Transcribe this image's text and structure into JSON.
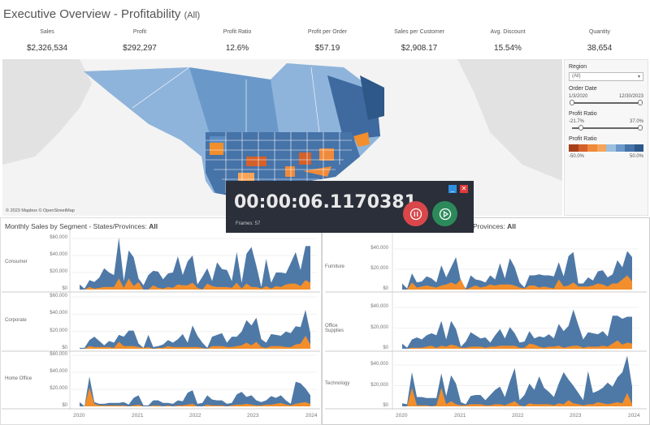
{
  "header": {
    "title": "Executive Overview - Profitability",
    "filter": "(All)"
  },
  "kpis": [
    {
      "label": "Sales",
      "value": "$2,326,534"
    },
    {
      "label": "Profit",
      "value": "$292,297"
    },
    {
      "label": "Profit Ratio",
      "value": "12.6%"
    },
    {
      "label": "Profit per Order",
      "value": "$57.19"
    },
    {
      "label": "Sales per Customer",
      "value": "$2,908.17"
    },
    {
      "label": "Avg. Discount",
      "value": "15.54%"
    },
    {
      "label": "Quantity",
      "value": "38,654"
    }
  ],
  "map": {
    "credit": "© 2023 Mapbox © OpenStreetMap"
  },
  "filters": {
    "region_label": "Region",
    "region_value": "(All)",
    "date_label": "Order Date",
    "date_min": "1/3/2020",
    "date_max": "12/30/2023",
    "ratio_label": "Profit Ratio",
    "ratio_min": "-21.7%",
    "ratio_max": "37.0%",
    "legend_label": "Profit Ratio",
    "legend_min": "-50.0%",
    "legend_max": "50.0%",
    "legend_colors": [
      "#a6401b",
      "#d4602a",
      "#ef8a3a",
      "#f5a55a",
      "#9cbfe0",
      "#6a99c9",
      "#4673a8",
      "#2d5888"
    ]
  },
  "recorder": {
    "time": "00:00:06.1170381",
    "frames": "Frames: 57",
    "minimize": "_",
    "close": "✕"
  },
  "colors": {
    "sales": "#4e79a7",
    "profit": "#f28e2b"
  },
  "chart_data": [
    {
      "type": "area",
      "title": "Monthly Sales by Segment - States/Provinces:",
      "title_bold": "All",
      "x_ticks": [
        "2020",
        "2021",
        "2022",
        "2023",
        "2024"
      ],
      "ylim": [
        0,
        60000
      ],
      "y_ticks": [
        "$60,000",
        "$40,000",
        "$20,000",
        "$0"
      ],
      "panels": [
        {
          "name": "Consumer",
          "sales": [
            6000,
            1000,
            11000,
            9000,
            14000,
            25000,
            20000,
            17000,
            61000,
            10000,
            46000,
            38000,
            13000,
            5000,
            17000,
            22000,
            21000,
            12000,
            19000,
            20000,
            39000,
            17000,
            33000,
            40000,
            6000,
            15000,
            25000,
            10000,
            32000,
            24000,
            23000,
            10000,
            44000,
            8000,
            42000,
            50000,
            28000,
            3000,
            36000,
            8000,
            20000,
            20000,
            19000,
            31000,
            44000,
            23000,
            51000,
            51000
          ],
          "profit": [
            0,
            0,
            3000,
            1000,
            2000,
            3000,
            3000,
            3000,
            13000,
            2000,
            13000,
            4000,
            9000,
            0,
            0,
            5000,
            2000,
            1000,
            3000,
            2000,
            6000,
            5000,
            5000,
            8000,
            2000,
            0,
            7000,
            4000,
            3000,
            3000,
            3000,
            2000,
            8000,
            1000,
            7000,
            3000,
            3000,
            1000,
            4000,
            1000,
            4000,
            3000,
            6000,
            7000,
            7000,
            4000,
            11000,
            8000
          ]
        },
        {
          "name": "Corporate",
          "sales": [
            1000,
            1000,
            10000,
            14000,
            9000,
            4000,
            9000,
            7000,
            16000,
            14000,
            21000,
            21000,
            6000,
            1000,
            16000,
            2000,
            3000,
            5000,
            10000,
            7000,
            11000,
            17000,
            7000,
            27000,
            15000,
            7000,
            1000,
            14000,
            16000,
            18000,
            7000,
            14000,
            14000,
            20000,
            33000,
            27000,
            36000,
            11000,
            7000,
            17000,
            16000,
            15000,
            20000,
            18000,
            26000,
            25000,
            45000,
            18000
          ],
          "profit": [
            0,
            0,
            3000,
            2000,
            2000,
            2000,
            2000,
            1000,
            8000,
            3000,
            3000,
            3000,
            2000,
            1000,
            2000,
            0,
            1000,
            1000,
            3000,
            2000,
            2000,
            2000,
            2000,
            2000,
            2000,
            1000,
            0,
            3000,
            3000,
            3000,
            2000,
            2000,
            3000,
            4000,
            7000,
            4000,
            8000,
            2000,
            1000,
            3000,
            3000,
            3000,
            2000,
            2000,
            5000,
            6000,
            15000,
            5000
          ]
        },
        {
          "name": "Home Office",
          "sales": [
            5000,
            0,
            35000,
            5000,
            3000,
            3000,
            4000,
            4000,
            4000,
            5000,
            2000,
            10000,
            13000,
            1000,
            1000,
            7000,
            7000,
            4000,
            4000,
            3000,
            7000,
            6000,
            16000,
            19000,
            3000,
            4000,
            13000,
            8000,
            7000,
            7000,
            3000,
            4000,
            14000,
            17000,
            11000,
            13000,
            7000,
            5000,
            7000,
            12000,
            10000,
            13000,
            7000,
            3000,
            29000,
            27000,
            21000,
            13000
          ],
          "profit": [
            0,
            0,
            22000,
            3000,
            1000,
            1000,
            1000,
            1000,
            1000,
            1000,
            0,
            1000,
            2000,
            0,
            0,
            1000,
            1000,
            0,
            1000,
            0,
            1000,
            1000,
            2000,
            3000,
            0,
            0,
            2000,
            1000,
            1000,
            1000,
            0,
            1000,
            2000,
            2000,
            3000,
            2000,
            1000,
            1000,
            2000,
            2000,
            3000,
            4000,
            2000,
            1000,
            3000,
            4000,
            5000,
            3000
          ]
        }
      ]
    },
    {
      "type": "area",
      "title": "Provinces:",
      "title_bold": "All",
      "x_ticks": [
        "2020",
        "2021",
        "2022",
        "2023",
        "2024"
      ],
      "ylim": [
        0,
        40000
      ],
      "y_ticks": [
        "$40,000",
        "$20,000",
        "$0"
      ],
      "panels": [
        {
          "name": "Furniture",
          "sales": [
            6000,
            1000,
            16000,
            7000,
            8000,
            13000,
            11000,
            7000,
            24000,
            12000,
            22000,
            32000,
            8000,
            1000,
            14000,
            10000,
            9000,
            7000,
            14000,
            10000,
            26000,
            11000,
            31000,
            22000,
            7000,
            2000,
            14000,
            14000,
            15000,
            14000,
            14000,
            13000,
            27000,
            13000,
            33000,
            37000,
            6000,
            6000,
            12000,
            9000,
            18000,
            19000,
            12000,
            15000,
            29000,
            22000,
            38000,
            32000
          ],
          "profit": [
            0,
            0,
            7000,
            2000,
            3000,
            4000,
            3000,
            2000,
            4000,
            5000,
            7000,
            5000,
            10000,
            0,
            2000,
            4000,
            2000,
            3000,
            5000,
            4000,
            5000,
            5000,
            5000,
            4000,
            2000,
            1000,
            4000,
            4000,
            2000,
            3000,
            2000,
            1000,
            10000,
            3000,
            4000,
            7000,
            3000,
            3000,
            3000,
            4000,
            6000,
            5000,
            3000,
            6000,
            6000,
            10000,
            14000,
            8000
          ]
        },
        {
          "name": "Office Supplies",
          "sales": [
            5000,
            1000,
            9000,
            11000,
            9000,
            13000,
            15000,
            13000,
            27000,
            9000,
            27000,
            19000,
            2000,
            7000,
            16000,
            13000,
            10000,
            11000,
            6000,
            13000,
            19000,
            10000,
            21000,
            15000,
            6000,
            7000,
            17000,
            10000,
            12000,
            11000,
            14000,
            10000,
            24000,
            17000,
            22000,
            38000,
            23000,
            9000,
            16000,
            15000,
            14000,
            17000,
            12000,
            32000,
            32000,
            29000,
            31000,
            31000
          ],
          "profit": [
            0,
            0,
            1000,
            1000,
            1000,
            2000,
            3000,
            1000,
            3000,
            2000,
            4000,
            3000,
            1000,
            1000,
            2000,
            2000,
            2000,
            1000,
            2000,
            2000,
            3000,
            3000,
            3000,
            3000,
            1000,
            1000,
            5000,
            4000,
            2000,
            1000,
            2000,
            2000,
            3000,
            1000,
            2000,
            3000,
            3000,
            1000,
            2000,
            2000,
            2000,
            3000,
            2000,
            5000,
            8000,
            4000,
            6000,
            5000
          ]
        },
        {
          "name": "Technology",
          "sales": [
            3000,
            2000,
            33000,
            9000,
            9000,
            8000,
            8000,
            8000,
            32000,
            10000,
            30000,
            22000,
            4000,
            2000,
            10000,
            11000,
            11000,
            6000,
            11000,
            16000,
            19000,
            9000,
            24000,
            37000,
            6000,
            11000,
            22000,
            16000,
            29000,
            18000,
            14000,
            9000,
            22000,
            33000,
            26000,
            20000,
            13000,
            6000,
            34000,
            13000,
            15000,
            18000,
            23000,
            19000,
            28000,
            33000,
            49000,
            19000
          ],
          "profit": [
            0,
            0,
            18000,
            1000,
            1000,
            1000,
            0,
            1000,
            18000,
            2000,
            5000,
            2000,
            1000,
            1000,
            2000,
            2000,
            2000,
            1000,
            1000,
            2000,
            2000,
            1000,
            3000,
            5000,
            1000,
            0,
            3000,
            2000,
            2000,
            2000,
            2000,
            1000,
            3000,
            2000,
            6000,
            3000,
            2000,
            1000,
            2000,
            2000,
            4000,
            3000,
            2000,
            3000,
            4000,
            3000,
            13000,
            2000
          ]
        }
      ]
    }
  ]
}
